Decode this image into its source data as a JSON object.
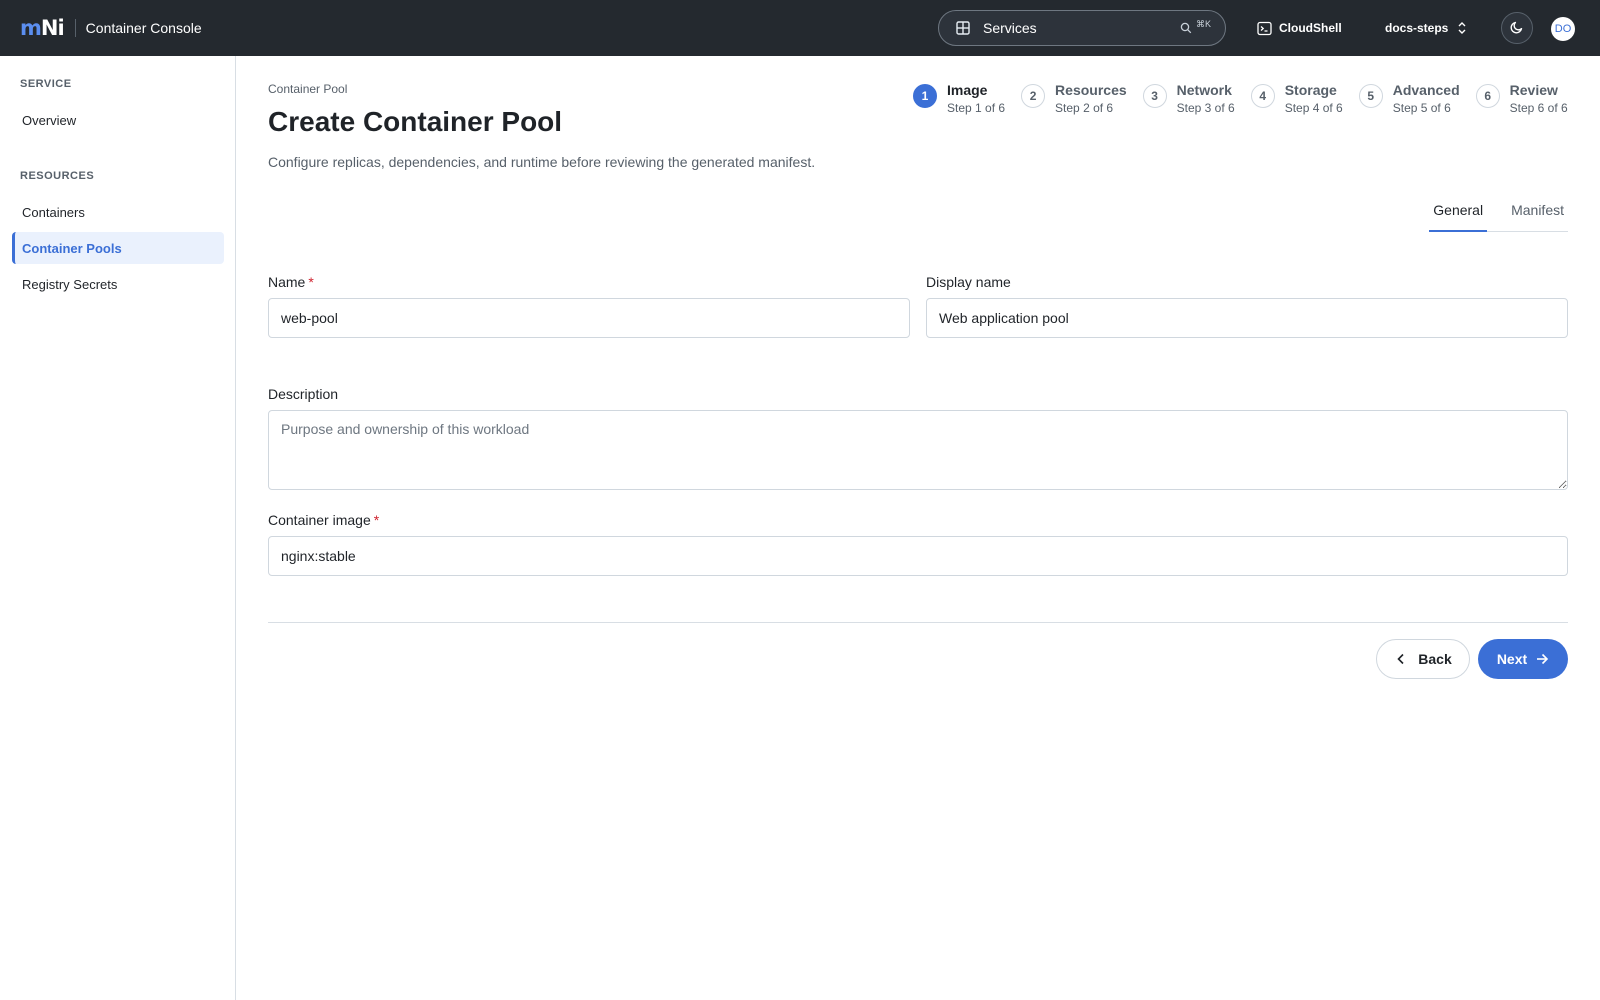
{
  "topbar": {
    "logo_part1": "m",
    "logo_part2": "Ni",
    "app_title": "Container Console",
    "search_label": "Services",
    "search_shortcut": "⌘K",
    "cloudshell_label": "CloudShell",
    "project_label": "docs-steps",
    "avatar_initials": "DO"
  },
  "sidebar": {
    "sections": [
      {
        "title": "SERVICE",
        "items": [
          {
            "label": "Overview",
            "active": false
          }
        ]
      },
      {
        "title": "RESOURCES",
        "items": [
          {
            "label": "Containers",
            "active": false
          },
          {
            "label": "Container Pools",
            "active": true
          },
          {
            "label": "Registry Secrets",
            "active": false
          }
        ]
      }
    ]
  },
  "page": {
    "breadcrumb": "Container Pool",
    "title": "Create Container Pool",
    "subtitle": "Configure replicas, dependencies, and runtime before reviewing the generated manifest."
  },
  "stepper": [
    {
      "num": "1",
      "label": "Image",
      "sub": "Step 1 of 6",
      "active": true
    },
    {
      "num": "2",
      "label": "Resources",
      "sub": "Step 2 of 6",
      "active": false
    },
    {
      "num": "3",
      "label": "Network",
      "sub": "Step 3 of 6",
      "active": false
    },
    {
      "num": "4",
      "label": "Storage",
      "sub": "Step 4 of 6",
      "active": false
    },
    {
      "num": "5",
      "label": "Advanced",
      "sub": "Step 5 of 6",
      "active": false
    },
    {
      "num": "6",
      "label": "Review",
      "sub": "Step 6 of 6",
      "active": false
    }
  ],
  "tabs": [
    {
      "label": "General",
      "active": true
    },
    {
      "label": "Manifest",
      "active": false
    }
  ],
  "form": {
    "name_label": "Name",
    "name_value": "web-pool",
    "display_label": "Display name",
    "display_value": "Web application pool",
    "description_label": "Description",
    "description_placeholder": "Purpose and ownership of this workload",
    "image_label": "Container image",
    "image_value": "nginx:stable",
    "required_mark": "*"
  },
  "actions": {
    "back_label": "Back",
    "next_label": "Next"
  },
  "colors": {
    "accent": "#3b6fd6",
    "topbar": "#24292f",
    "required": "#cf222e"
  }
}
